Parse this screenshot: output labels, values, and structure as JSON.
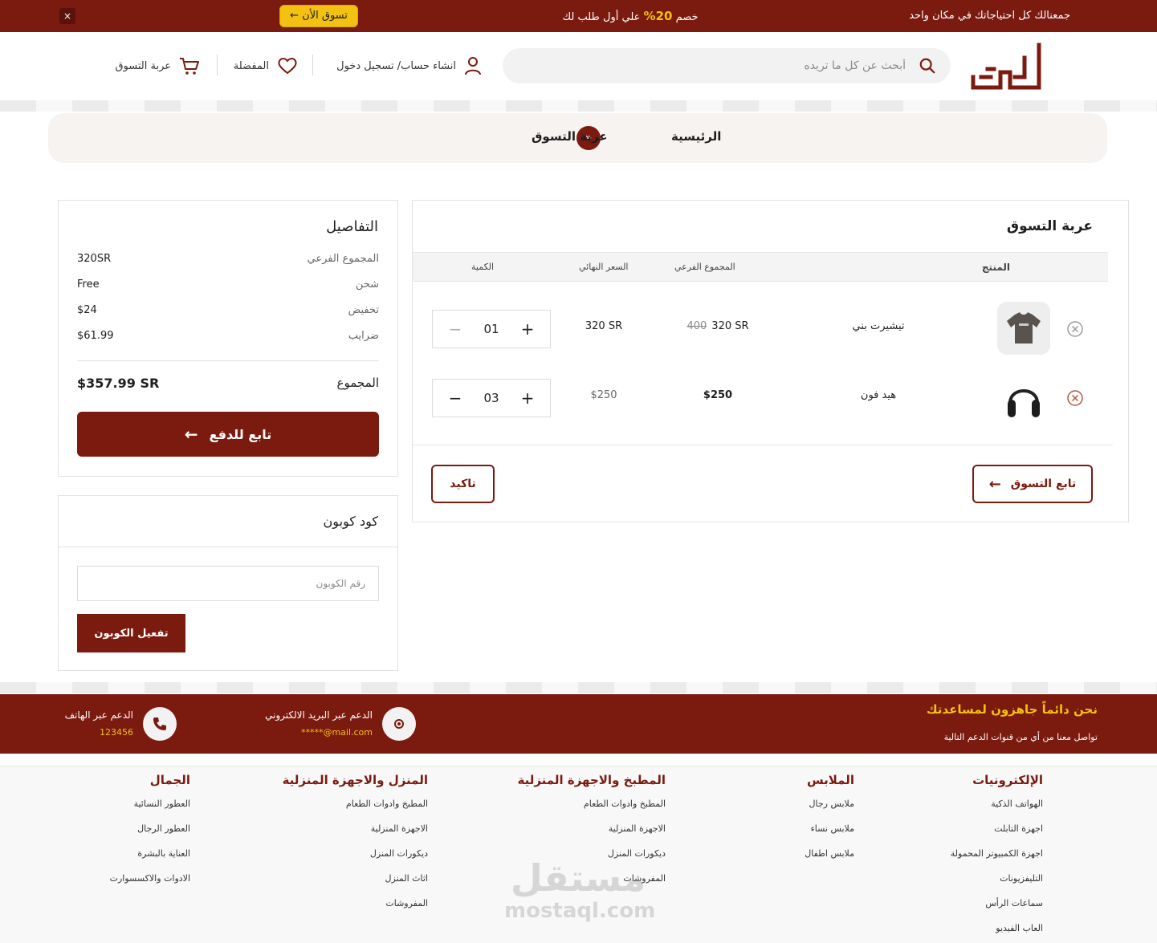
{
  "topbar": {
    "close": "×",
    "shop_now": "تسوق الأن",
    "promo_prefix": "خصم",
    "promo_pct": "20%",
    "promo_suffix": "علي أول طلب لك",
    "tagline": "جمعنالك كل احتياجاتك في مكان واحد"
  },
  "header": {
    "search_placeholder": "أبحث عن كل ما تريده",
    "account": "انشاء حساب/ تسجيل دخول",
    "wishlist": "المفضلة",
    "cart": "عربة التسوق"
  },
  "breadcrumb": {
    "home": "الرئيسية",
    "separator": "»",
    "current": "عربة التسوق"
  },
  "cart": {
    "title": "عربة التسوق",
    "columns": {
      "product": "المنتج",
      "subtotal": "المجموع الفرعي",
      "final": "السعر النهائي",
      "quantity": "الكمية"
    },
    "items": [
      {
        "name": "تيشيرت بني",
        "old_price": "400",
        "subtotal": "320 SR",
        "final": "320 SR",
        "qty": "01",
        "minus": "−",
        "plus": "+"
      },
      {
        "name": "هيد فون",
        "subtotal": "$250",
        "final": "$250",
        "qty": "03",
        "minus": "−",
        "plus": "+"
      }
    ],
    "continue_shopping": "تابع التسوق",
    "confirm": "تاكيد"
  },
  "details": {
    "title": "التفاصيل",
    "rows": [
      {
        "label": "المجموع الفرعي",
        "value": "320SR"
      },
      {
        "label": "شحن",
        "value": "Free"
      },
      {
        "label": "تخفيض",
        "value": "$24"
      },
      {
        "label": "ضرايب",
        "value": "$61.99"
      }
    ],
    "total_label": "المجموع",
    "total_value": "$357.99 SR",
    "checkout": "تابع للدفع"
  },
  "coupon": {
    "title": "كود كوبون",
    "placeholder": "رقم الكوبون",
    "apply": "تفعيل الكوبون"
  },
  "support": {
    "heading": "نحن دائماً جاهزون لمساعدتك",
    "sub": "تواصل معنا من أي من قنوات الدعم التالية",
    "email_label": "الدعم عبر البريد الالكتروني",
    "email_value": "*****@mail.com",
    "phone_label": "الدعم عبر الهاتف",
    "phone_value": "123456"
  },
  "footer": {
    "columns": [
      {
        "title": "الإلكترونيات",
        "links": [
          "الهواتف الذكية",
          "اجهزة التابلت",
          "اجهزة الكمبيوتر المحمولة",
          "التليفزيونات",
          "سماعات الرأس",
          "العاب الفيديو"
        ]
      },
      {
        "title": "الملابس",
        "links": [
          "ملابس رجال",
          "ملابس نساء",
          "ملابس اطفال"
        ]
      },
      {
        "title": "المطبخ والاجهزة المنزلية",
        "links": [
          "المطبخ وادوات الطعام",
          "الاجهزة المنزلية",
          "ديكورات المنزل",
          "المفروشات"
        ]
      },
      {
        "title": "المنزل والاجهزة المنزلية",
        "links": [
          "المطبخ وادوات الطعام",
          "الاجهزة المنزلية",
          "ديكورات المنزل",
          "اثاث المنزل",
          "المفروشات"
        ]
      },
      {
        "title": "الجمال",
        "links": [
          "العطور النسائية",
          "العطور الرجال",
          "العناية بالبشرة",
          "الادوات والاكسسوارت"
        ]
      }
    ]
  },
  "watermark": {
    "arabic": "مستقل",
    "latin": "mostaql.com"
  },
  "colors": {
    "brand": "#7b1a0f",
    "accent": "#f3c111"
  }
}
